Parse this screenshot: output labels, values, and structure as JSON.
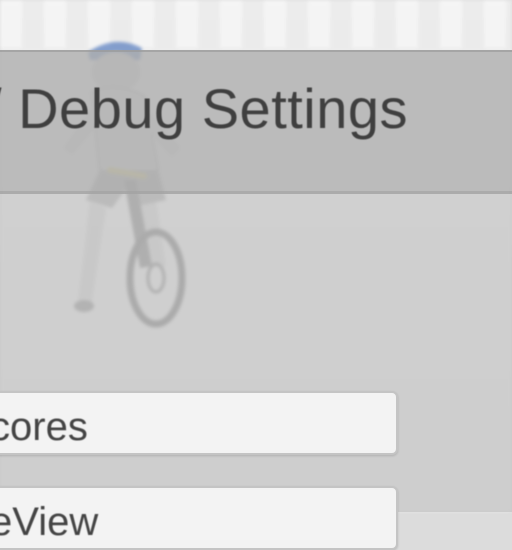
{
  "panel": {
    "title": "/ Debug Settings"
  },
  "buttons": [
    {
      "label": "cores"
    },
    {
      "label": "eView"
    }
  ],
  "colors": {
    "panel_overlay": "#b9b9b9",
    "button_background": "#f3f3f3",
    "text": "#3f3f3f",
    "character_helmet": "#2f5fb3",
    "character_jersey": "#d9d9d9",
    "bike_wheel": "#5a5a5a"
  },
  "scene": {
    "character": "cyclist-on-bicycle"
  }
}
